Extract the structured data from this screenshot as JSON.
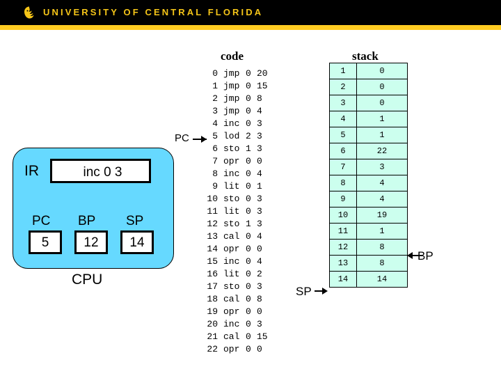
{
  "header": {
    "brand": "UNIVERSITY OF CENTRAL FLORIDA",
    "logo_icon": "pegasus-icon",
    "bar_color": "#000000",
    "stripe_color": "#ffcc22",
    "text_color": "#f5c518"
  },
  "code_panel": {
    "title": "code",
    "pointer_label": "PC",
    "pointer_target_line": 5,
    "lines": [
      {
        "addr": "0",
        "op": "jmp",
        "lvl": "0",
        "arg": "20"
      },
      {
        "addr": "1",
        "op": "jmp",
        "lvl": "0",
        "arg": "15"
      },
      {
        "addr": "2",
        "op": "jmp",
        "lvl": "0",
        "arg": "8"
      },
      {
        "addr": "3",
        "op": "jmp",
        "lvl": "0",
        "arg": "4"
      },
      {
        "addr": "4",
        "op": "inc",
        "lvl": "0",
        "arg": "3"
      },
      {
        "addr": "5",
        "op": "lod",
        "lvl": "2",
        "arg": "3"
      },
      {
        "addr": "6",
        "op": "sto",
        "lvl": "1",
        "arg": "3"
      },
      {
        "addr": "7",
        "op": "opr",
        "lvl": "0",
        "arg": "0"
      },
      {
        "addr": "8",
        "op": "inc",
        "lvl": "0",
        "arg": "4"
      },
      {
        "addr": "9",
        "op": "lit",
        "lvl": "0",
        "arg": "1"
      },
      {
        "addr": "10",
        "op": "sto",
        "lvl": "0",
        "arg": "3"
      },
      {
        "addr": "11",
        "op": "lit",
        "lvl": "0",
        "arg": "3"
      },
      {
        "addr": "12",
        "op": "sto",
        "lvl": "1",
        "arg": "3"
      },
      {
        "addr": "13",
        "op": "cal",
        "lvl": "0",
        "arg": "4"
      },
      {
        "addr": "14",
        "op": "opr",
        "lvl": "0",
        "arg": "0"
      },
      {
        "addr": "15",
        "op": "inc",
        "lvl": "0",
        "arg": "4"
      },
      {
        "addr": "16",
        "op": "lit",
        "lvl": "0",
        "arg": "2"
      },
      {
        "addr": "17",
        "op": "sto",
        "lvl": "0",
        "arg": "3"
      },
      {
        "addr": "18",
        "op": "cal",
        "lvl": "0",
        "arg": "8"
      },
      {
        "addr": "19",
        "op": "opr",
        "lvl": "0",
        "arg": "0"
      },
      {
        "addr": "20",
        "op": "inc",
        "lvl": "0",
        "arg": "3"
      },
      {
        "addr": "21",
        "op": "cal",
        "lvl": "0",
        "arg": "15"
      },
      {
        "addr": "22",
        "op": "opr",
        "lvl": "0",
        "arg": "0"
      }
    ]
  },
  "stack_panel": {
    "title": "stack",
    "cell_color": "#ccffee",
    "sp_annotation": "SP",
    "bp_annotation": "BP",
    "sp_points_to": 14,
    "bp_points_to": 12,
    "rows": [
      {
        "index": "1",
        "value": "0"
      },
      {
        "index": "2",
        "value": "0"
      },
      {
        "index": "3",
        "value": "0"
      },
      {
        "index": "4",
        "value": "1"
      },
      {
        "index": "5",
        "value": "1"
      },
      {
        "index": "6",
        "value": "22"
      },
      {
        "index": "7",
        "value": "3"
      },
      {
        "index": "8",
        "value": "4"
      },
      {
        "index": "9",
        "value": "4"
      },
      {
        "index": "10",
        "value": "19"
      },
      {
        "index": "11",
        "value": "1"
      },
      {
        "index": "12",
        "value": "8"
      },
      {
        "index": "13",
        "value": "8"
      },
      {
        "index": "14",
        "value": "14"
      }
    ]
  },
  "cpu": {
    "caption": "CPU",
    "box_color": "#66d9ff",
    "ir_label": "IR",
    "ir_value": "inc 0 3",
    "registers": [
      {
        "label": "PC",
        "value": "5"
      },
      {
        "label": "BP",
        "value": "12"
      },
      {
        "label": "SP",
        "value": "14"
      }
    ]
  }
}
